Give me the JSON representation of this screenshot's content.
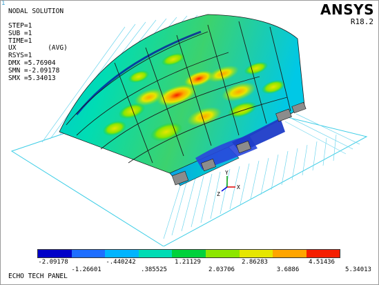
{
  "corner_marker": "1",
  "title": "NODAL SOLUTION",
  "info_lines": [
    "STEP=1",
    "SUB =1",
    "TIME=1",
    "UX        (AVG)",
    "RSYS=1",
    "DMX =5.76904",
    "SMN =-2.09178",
    "SMX =5.34013"
  ],
  "brand": {
    "logo": "ANSYS",
    "release": "R18.2"
  },
  "axis_labels": {
    "y": "Y",
    "z": "Z",
    "x": "X"
  },
  "legend": {
    "colors": [
      "#0000c8",
      "#1e6eff",
      "#00b4ff",
      "#00dcb4",
      "#00d23c",
      "#8ce600",
      "#e6e600",
      "#ffa500",
      "#f51e00"
    ],
    "upper_ticks": [
      "-2.09178",
      "-.440242",
      "1.21129",
      "2.86283",
      "4.51436"
    ],
    "lower_ticks": [
      "-1.26601",
      ".385525",
      "2.03706",
      "3.6886",
      "5.34013"
    ]
  },
  "caption": "ECHO TECH PANEL"
}
